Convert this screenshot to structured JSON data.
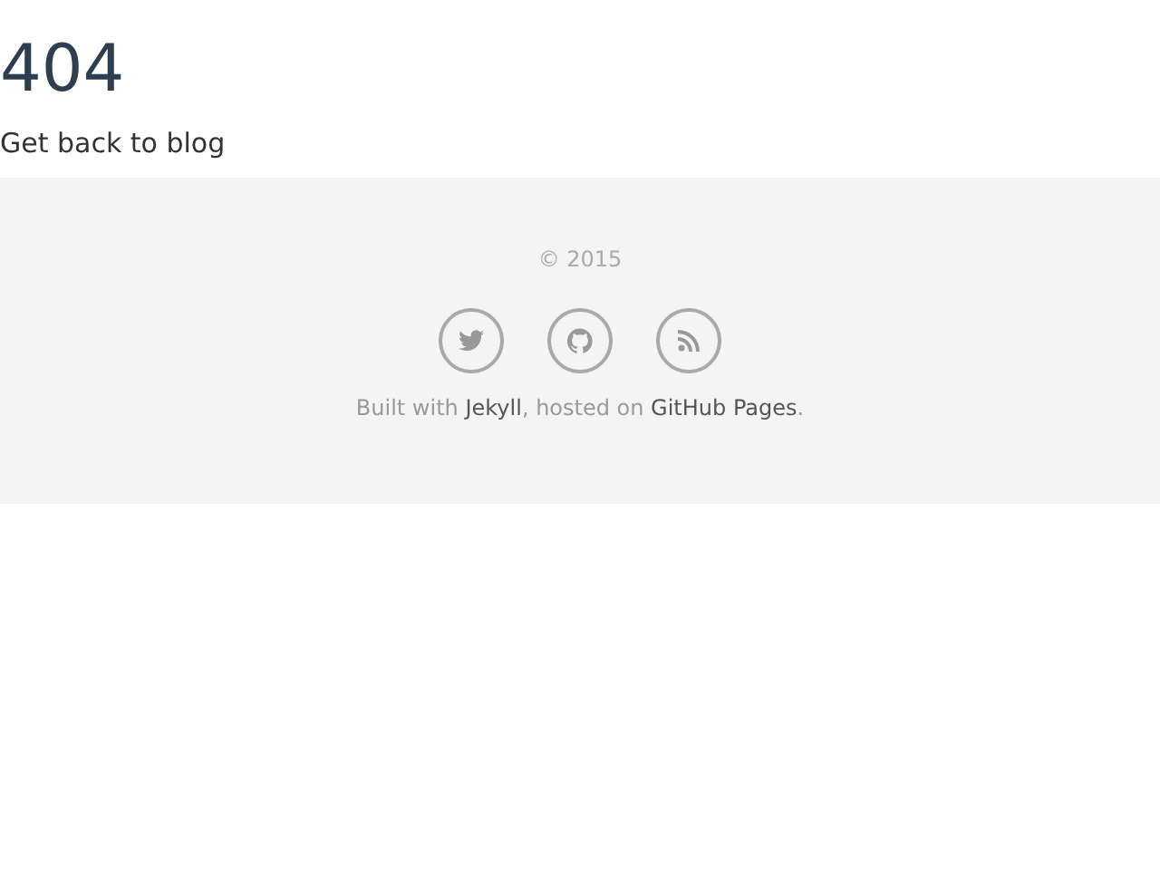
{
  "heading": "404",
  "back_link": "Get back to blog",
  "footer": {
    "copyright": "© 2015",
    "social": [
      {
        "kind": "twitter"
      },
      {
        "kind": "github"
      },
      {
        "kind": "rss"
      }
    ],
    "credits": [
      {
        "kind": "text",
        "text": "Built with "
      },
      {
        "kind": "link",
        "text": "Jekyll"
      },
      {
        "kind": "text",
        "text": ", hosted on "
      },
      {
        "kind": "link",
        "text": "GitHub Pages"
      },
      {
        "kind": "text",
        "text": "."
      }
    ]
  }
}
